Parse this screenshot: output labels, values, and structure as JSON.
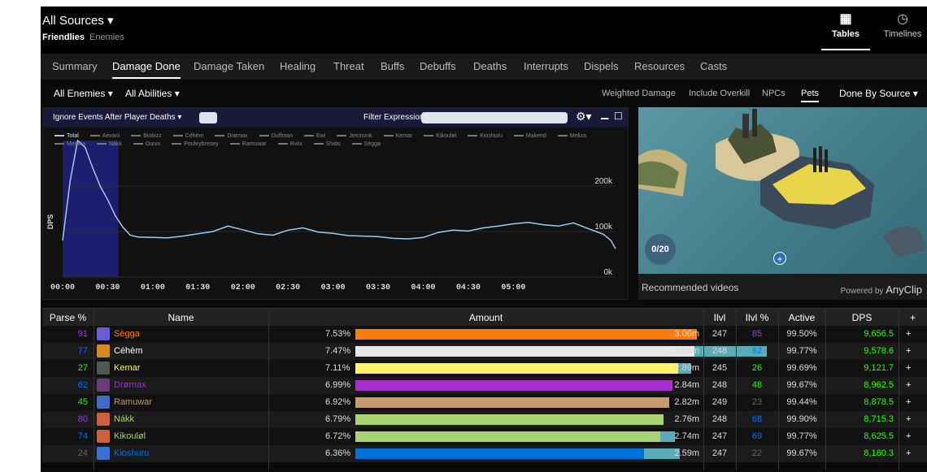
{
  "header": {
    "source_title": "All Sources ▾",
    "friendlies": "Friendlies",
    "enemies": "Enemies",
    "views": [
      {
        "label": "Tables",
        "icon": "grid-icon",
        "glyph": "▦"
      },
      {
        "label": "Timelines",
        "icon": "clock-icon",
        "glyph": "◷"
      }
    ]
  },
  "tabs": [
    "Summary",
    "Damage Done",
    "Damage Taken",
    "Healing",
    "Threat",
    "Buffs",
    "Debuffs",
    "Deaths",
    "Interrupts",
    "Dispels",
    "Resources",
    "Casts"
  ],
  "active_tab": "Damage Done",
  "filters": {
    "left": [
      "All Enemies ▾",
      "All Abilities ▾"
    ],
    "right": [
      "Weighted Damage",
      "Include Overkill",
      "NPCs",
      "Pets"
    ],
    "active_right": "Pets",
    "done_by": "Done By Source ▾"
  },
  "chart_toolbar": {
    "ignore_events": "Ignore Events After Player Deaths ▾",
    "filter_label": "Filter Expression:",
    "filter_value": "",
    "gear": "⚙▾",
    "minimize": "▁",
    "maximize": "☐"
  },
  "chart_data": {
    "type": "line",
    "ylabel": "DPS",
    "xlabel": "",
    "ylim": [
      0,
      300000
    ],
    "yticks": [
      {
        "v": 0,
        "label": "0k"
      },
      {
        "v": 100000,
        "label": "100k"
      },
      {
        "v": 200000,
        "label": "200k"
      }
    ],
    "xticks": [
      "00:00",
      "00:30",
      "01:00",
      "01:30",
      "02:00",
      "02:30",
      "03:00",
      "03:30",
      "04:00",
      "04:30",
      "05:00"
    ],
    "highlight_range_sec": [
      0,
      37
    ],
    "legend": [
      "Total",
      "Aevani",
      "Biobizz",
      "Céhèm",
      "Drørnax",
      "Duffman",
      "Ewi",
      "Jenmonk",
      "Kemar",
      "Kikouløl",
      "Kioshuru",
      "Makend",
      "Meliza",
      "Meinea",
      "Nákk",
      "Ounix",
      "Pouleybresey",
      "Ramuwar",
      "Rviix",
      "Shido",
      "Sègga"
    ],
    "series": [
      {
        "name": "Total",
        "color": "#9fcbf0",
        "x": [
          0,
          5,
          10,
          15,
          20,
          25,
          30,
          35,
          40,
          45,
          50,
          60,
          70,
          80,
          90,
          100,
          110,
          120,
          130,
          140,
          150,
          160,
          170,
          180,
          190,
          200,
          210,
          220,
          230,
          240,
          250,
          260,
          270,
          280,
          290,
          300,
          310,
          320,
          330,
          340,
          350,
          355,
          360,
          365,
          368
        ],
        "values": [
          80000,
          210000,
          300000,
          285000,
          240000,
          200000,
          170000,
          135000,
          110000,
          92000,
          88000,
          87000,
          86000,
          90000,
          95000,
          100000,
          112000,
          104000,
          95000,
          92000,
          103000,
          108000,
          99000,
          96000,
          91000,
          90000,
          89000,
          85000,
          84000,
          87000,
          98000,
          103000,
          101000,
          108000,
          112000,
          117000,
          120000,
          115000,
          112000,
          119000,
          106000,
          100000,
          94000,
          80000,
          62000
        ]
      }
    ]
  },
  "video": {
    "caption": "Recommended videos",
    "powered_by": "Powered by",
    "brand": "AnyClip",
    "counter": "0/20",
    "plus": "+"
  },
  "table": {
    "headers": [
      "Parse %",
      "Name",
      "Amount",
      "Ilvl",
      "Ilvl %",
      "Active",
      "DPS",
      "+"
    ],
    "rows": [
      {
        "parse": "91",
        "parse_color": "#a335ee",
        "name": "Sègga",
        "name_color": "#ff7c0a",
        "spec_color": "#6b5bd6",
        "pct": "7.53%",
        "pct_value": 7.53,
        "bar_color": "#ff7c0a",
        "ext_value": 0,
        "amount": "3.06m",
        "ilvl": "247",
        "ilvl_pct": "85",
        "ilvl_color": "#a335ee",
        "active": "99.50%",
        "dps": "9,656.5"
      },
      {
        "parse": "77",
        "parse_color": "#0070ff",
        "name": "Céhèm",
        "name_color": "#ffffff",
        "spec_color": "#d48b20",
        "pct": "7.47%",
        "pct_value": 7.47,
        "bar_color": "#e8e8e8",
        "ext_value": 1.6,
        "amount": "3.04m",
        "ilvl": "248",
        "ilvl_pct": "62",
        "ilvl_color": "#0070ff",
        "active": "99.77%",
        "dps": "9,578.6"
      },
      {
        "parse": "27",
        "parse_color": "#1eff00",
        "name": "Kemar",
        "name_color": "#fff468",
        "spec_color": "#4d5a4f",
        "pct": "7.11%",
        "pct_value": 7.11,
        "bar_color": "#fff468",
        "ext_value": 0.3,
        "amount": "2.89m",
        "ilvl": "245",
        "ilvl_pct": "26",
        "ilvl_color": "#1eff00",
        "active": "99.69%",
        "dps": "9,121.7"
      },
      {
        "parse": "62",
        "parse_color": "#0070ff",
        "name": "Drørnax",
        "name_color": "#a330c9",
        "spec_color": "#6a3b7a",
        "pct": "6.99%",
        "pct_value": 6.99,
        "bar_color": "#a330c9",
        "ext_value": 0,
        "amount": "2.84m",
        "ilvl": "248",
        "ilvl_pct": "48",
        "ilvl_color": "#1eff00",
        "active": "99.67%",
        "dps": "8,962.5"
      },
      {
        "parse": "45",
        "parse_color": "#1eff00",
        "name": "Ramuwar",
        "name_color": "#c69b6d",
        "spec_color": "#3c6fc4",
        "pct": "6.92%",
        "pct_value": 6.92,
        "bar_color": "#c69b6d",
        "ext_value": 0,
        "amount": "2.82m",
        "ilvl": "249",
        "ilvl_pct": "23",
        "ilvl_color": "#666666",
        "active": "99.44%",
        "dps": "8,878.5"
      },
      {
        "parse": "80",
        "parse_color": "#a335ee",
        "name": "Nákk",
        "name_color": "#aad372",
        "spec_color": "#d0603a",
        "pct": "6.79%",
        "pct_value": 6.79,
        "bar_color": "#aad372",
        "ext_value": 0,
        "amount": "2.76m",
        "ilvl": "248",
        "ilvl_pct": "68",
        "ilvl_color": "#0070ff",
        "active": "99.90%",
        "dps": "8,715.3"
      },
      {
        "parse": "74",
        "parse_color": "#0070ff",
        "name": "Kikouløl",
        "name_color": "#aad372",
        "spec_color": "#d0603a",
        "pct": "6.72%",
        "pct_value": 6.72,
        "bar_color": "#aad372",
        "ext_value": 0.32,
        "amount": "2.74m",
        "ilvl": "247",
        "ilvl_pct": "69",
        "ilvl_color": "#0070ff",
        "active": "99.77%",
        "dps": "8,625.5"
      },
      {
        "parse": "24",
        "parse_color": "#666666",
        "name": "Kioshuru",
        "name_color": "#0070dd",
        "spec_color": "#3a6fd8",
        "pct": "6.36%",
        "pct_value": 6.36,
        "bar_color": "#0070dd",
        "ext_value": 0.8,
        "amount": "2.59m",
        "ilvl": "247",
        "ilvl_pct": "22",
        "ilvl_color": "#666666",
        "active": "99.67%",
        "dps": "8,160.3"
      }
    ],
    "row_plus": "+"
  }
}
